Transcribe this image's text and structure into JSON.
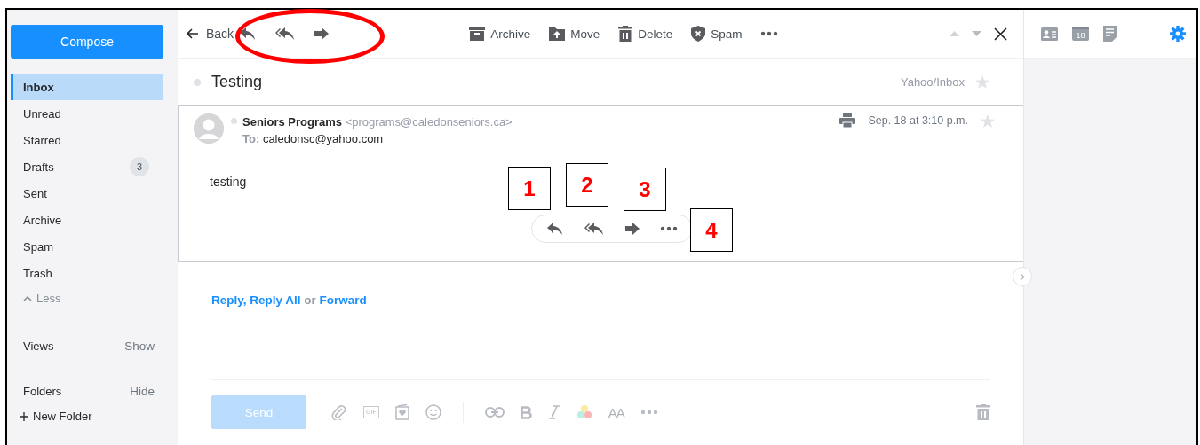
{
  "sidebar": {
    "compose": "Compose",
    "folders": [
      {
        "label": "Inbox",
        "selected": true
      },
      {
        "label": "Unread",
        "selected": false
      },
      {
        "label": "Starred",
        "selected": false
      },
      {
        "label": "Drafts",
        "selected": false,
        "count": "3"
      },
      {
        "label": "Sent",
        "selected": false
      },
      {
        "label": "Archive",
        "selected": false
      },
      {
        "label": "Spam",
        "selected": false
      },
      {
        "label": "Trash",
        "selected": false
      }
    ],
    "less": "Less",
    "sections": [
      {
        "label": "Views",
        "action": "Show"
      },
      {
        "label": "Folders",
        "action": "Hide"
      }
    ],
    "new_folder": "New Folder"
  },
  "toolbar": {
    "back": "Back",
    "actions": [
      {
        "kind": "archive",
        "label": "Archive"
      },
      {
        "kind": "move",
        "label": "Move"
      },
      {
        "kind": "delete",
        "label": "Delete"
      },
      {
        "kind": "spam",
        "label": "Spam"
      }
    ]
  },
  "message": {
    "subject": "Testing",
    "location": "Yahoo/Inbox",
    "sender_name": "Seniors Programs",
    "sender_email": "<programs@caledonseniors.ca>",
    "to_label": "To:",
    "to": "caledonsc@yahoo.com",
    "date": "Sep. 18 at 3:10 p.m.",
    "body": "testing"
  },
  "reply_links": {
    "reply": "Reply",
    "separator": ",",
    "reply_all": "Reply All",
    "conjunction": "or",
    "forward": "Forward"
  },
  "composer": {
    "send": "Send",
    "send_disabled": true,
    "gif": "GIF",
    "font_size": "AA"
  },
  "right_rail": {
    "calendar_day": "18"
  },
  "annotations": [
    {
      "label": "1"
    },
    {
      "label": "2"
    },
    {
      "label": "3"
    },
    {
      "label": "4"
    }
  ]
}
